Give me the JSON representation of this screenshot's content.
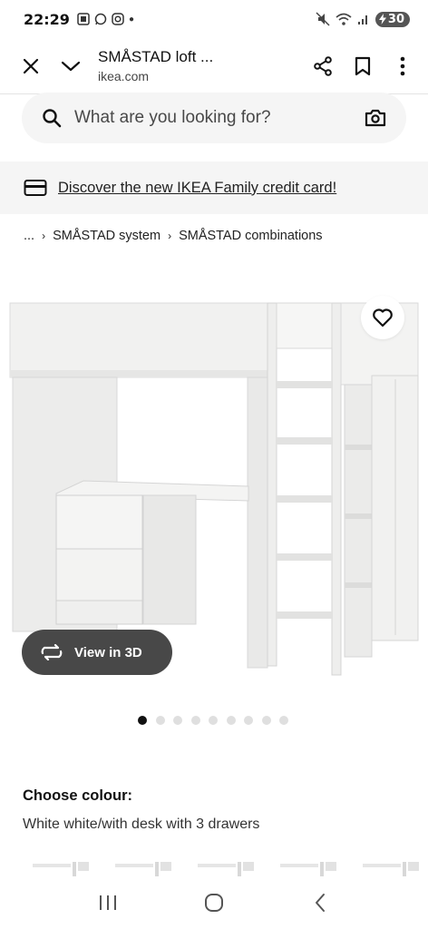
{
  "status_bar": {
    "time": "22:29",
    "battery": "30"
  },
  "browser": {
    "title": "SMÅSTAD loft ...",
    "url": "ikea.com"
  },
  "search": {
    "placeholder": "What are you looking for?"
  },
  "promo": {
    "text": "Discover the new IKEA Family credit card!"
  },
  "breadcrumb": {
    "items": [
      "...",
      "SMÅSTAD system",
      "SMÅSTAD combinations"
    ]
  },
  "product": {
    "view_3d_label": "View in 3D",
    "carousel": {
      "total": 9,
      "active_index": 0
    }
  },
  "colour": {
    "heading": "Choose colour:",
    "selected": "White white/with desk with 3 drawers"
  },
  "colors": {
    "dark_button": "#484848",
    "search_bg": "#f5f5f5",
    "dot_active": "#111111",
    "dot_inactive": "#dfdfdf"
  }
}
